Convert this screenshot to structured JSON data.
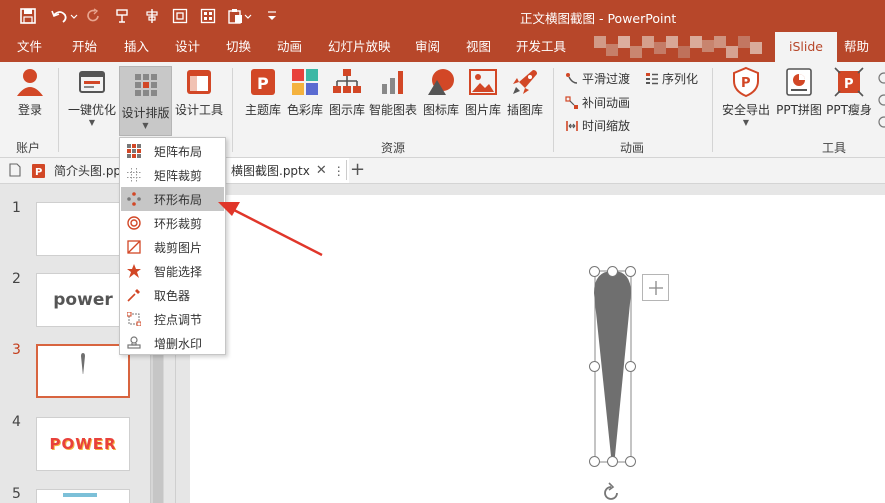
{
  "title_bar": {
    "document_title": "正文横图截图  -  PowerPoint",
    "quick_access": [
      "save-icon",
      "undo-icon",
      "redo-icon",
      "format-painter-icon",
      "align-center-icon",
      "select-icon",
      "grid-icon",
      "paste-icon",
      "customize-icon"
    ]
  },
  "tabs": [
    {
      "label": "文件"
    },
    {
      "label": "开始"
    },
    {
      "label": "插入"
    },
    {
      "label": "设计"
    },
    {
      "label": "切换"
    },
    {
      "label": "动画"
    },
    {
      "label": "幻灯片放映"
    },
    {
      "label": "审阅"
    },
    {
      "label": "视图"
    },
    {
      "label": "开发工具"
    },
    {
      "label": "iSlide"
    },
    {
      "label": "帮助"
    }
  ],
  "active_tab": "iSlide",
  "ribbon": {
    "account": {
      "login": "登录",
      "group": "账户"
    },
    "tools_left": {
      "optimize": "一键优化",
      "layout": "设计排版",
      "design_tools": "设计工具"
    },
    "resources": {
      "items": [
        "主题库",
        "色彩库",
        "图示库",
        "智能图表",
        "图标库",
        "图片库",
        "插图库"
      ],
      "group": "资源"
    },
    "animation": {
      "smooth": "平滑过渡",
      "sequence": "序列化",
      "tween": "补间动画",
      "time_scale": "时间缩放",
      "group": "动画"
    },
    "tools": {
      "safe_export": "安全导出",
      "ppt_merge": "PPT拼图",
      "ppt_slim": "PPT瘦身",
      "group": "工具"
    }
  },
  "dropdown": {
    "items": [
      "矩阵布局",
      "矩阵裁剪",
      "环形布局",
      "环形裁剪",
      "裁剪图片",
      "智能选择",
      "取色器",
      "控点调节",
      "增删水印"
    ],
    "highlighted": "环形布局"
  },
  "doc_tabs": [
    {
      "label": "简介头图.ppt"
    },
    {
      "label": "横图截图.pptx"
    }
  ],
  "thumbnails": [
    {
      "number": "1",
      "text": ""
    },
    {
      "number": "2",
      "text": "power"
    },
    {
      "number": "3",
      "text": ""
    },
    {
      "number": "4",
      "text": "POWER"
    },
    {
      "number": "5",
      "text": ""
    }
  ],
  "active_slide": "3",
  "colors": {
    "brand": "#b7472a",
    "highlight_arrow": "#e0362a",
    "shape_fill": "#6f6f6f"
  }
}
